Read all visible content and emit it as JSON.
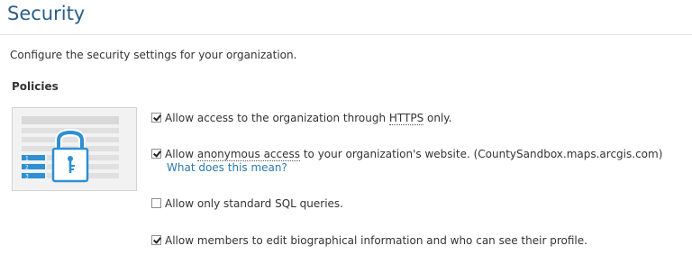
{
  "header": {
    "title": "Security"
  },
  "description": "Configure the security settings for your organization.",
  "section": {
    "title": "Policies"
  },
  "policies": [
    {
      "checked": true,
      "prefix": "Allow access to the organization through ",
      "term": "HTTPS",
      "suffix": " only."
    },
    {
      "checked": true,
      "prefix": "Allow ",
      "term": "anonymous access",
      "suffix": " to your organization's website. (CountySandbox.maps.arcgis.com)",
      "help_link": "What does this mean?"
    },
    {
      "checked": false,
      "text": "Allow only standard SQL queries."
    },
    {
      "checked": true,
      "text": "Allow members to edit biographical information and who can see their profile."
    }
  ],
  "illustration": {
    "icon": "padlock-icon",
    "list_numbers": [
      "1",
      "2",
      "3"
    ]
  },
  "colors": {
    "title": "#2a5d89",
    "link": "#2a7ab0",
    "accent": "#2e8fd2"
  }
}
